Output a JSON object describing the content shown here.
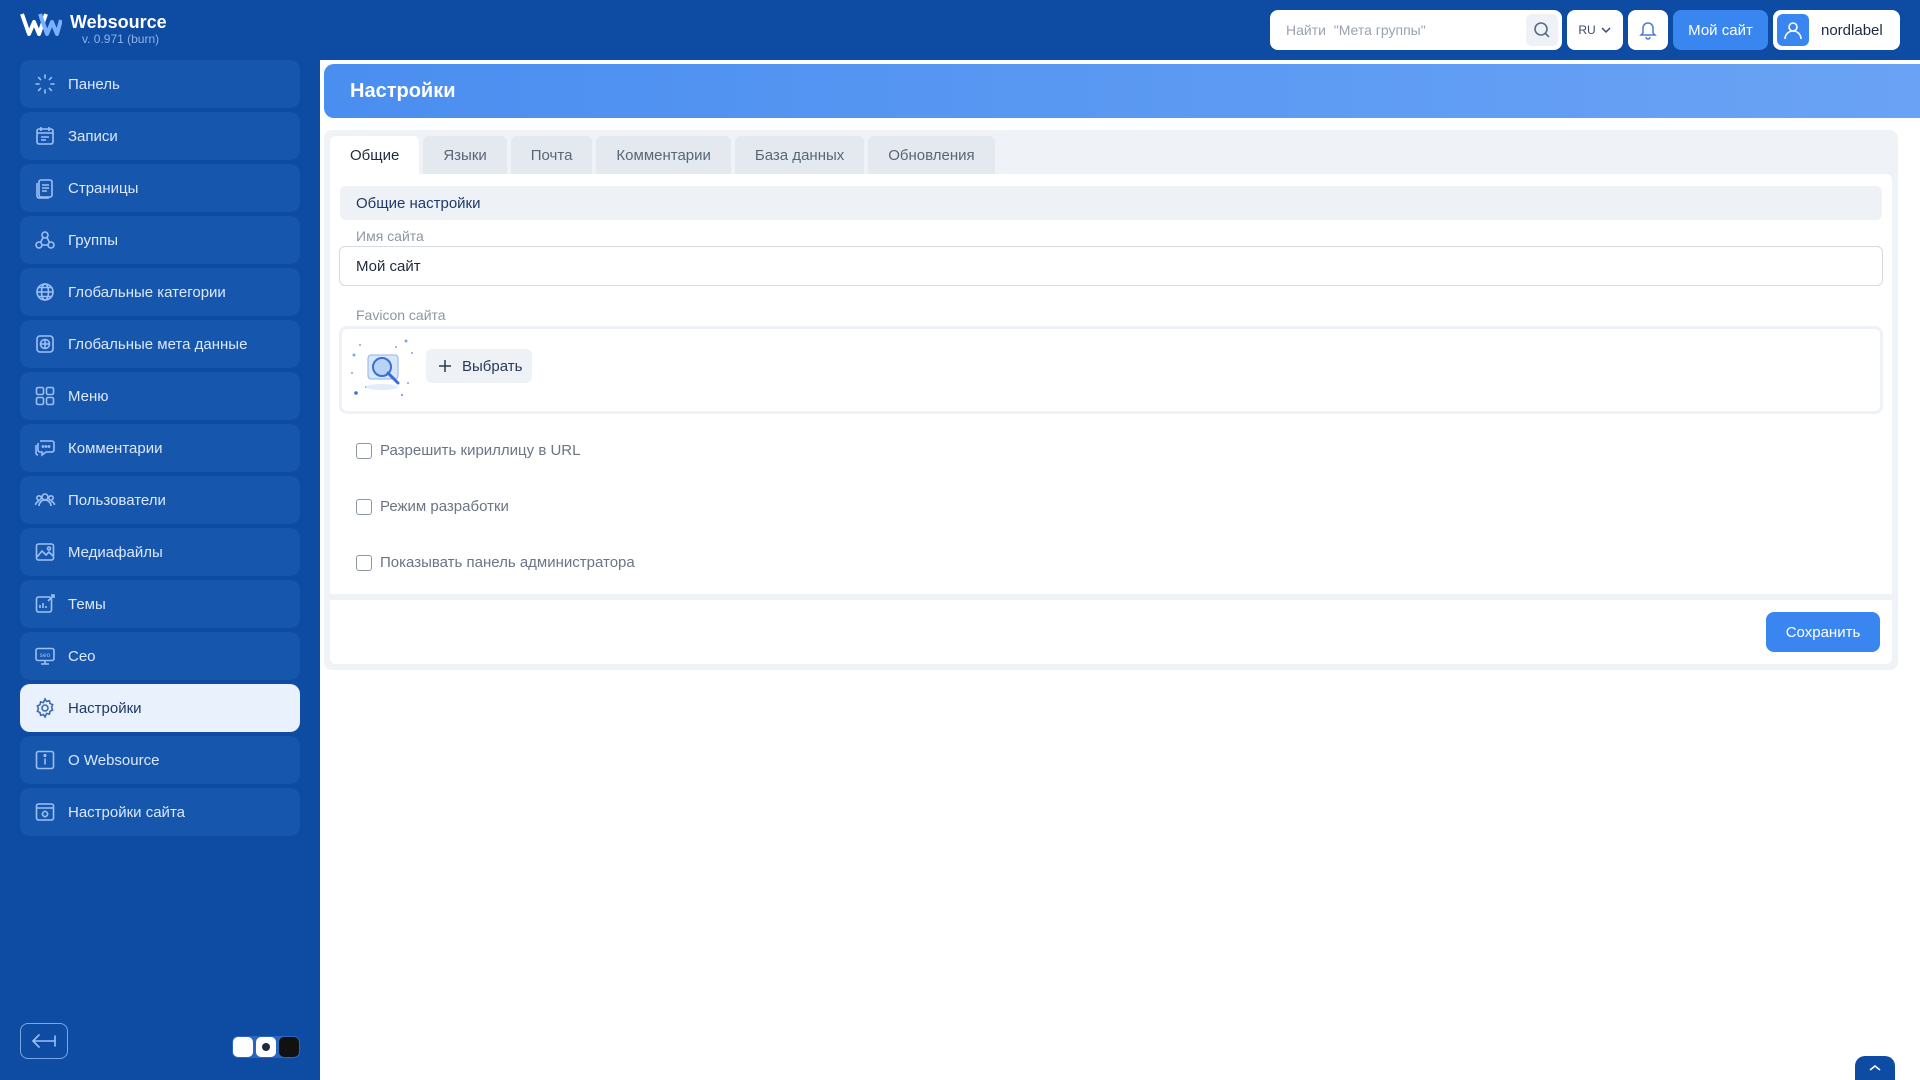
{
  "app": {
    "name": "Websource",
    "version": "v. 0.971 (burn)"
  },
  "header": {
    "search_placeholder": "Найти  \"Мета группы\"",
    "lang": "RU",
    "my_site_label": "Мой сайт",
    "username": "nordlabel"
  },
  "sidebar": {
    "items": [
      {
        "label": "Панель",
        "icon": "dashboard-icon"
      },
      {
        "label": "Записи",
        "icon": "posts-icon"
      },
      {
        "label": "Страницы",
        "icon": "pages-icon"
      },
      {
        "label": "Группы",
        "icon": "groups-icon"
      },
      {
        "label": "Глобальные категории",
        "icon": "global-categories-icon"
      },
      {
        "label": "Глобальные мета данные",
        "icon": "global-meta-icon"
      },
      {
        "label": "Меню",
        "icon": "menu-grid-icon"
      },
      {
        "label": "Комментарии",
        "icon": "comments-icon"
      },
      {
        "label": "Пользователи",
        "icon": "users-icon"
      },
      {
        "label": "Медиафайлы",
        "icon": "media-icon"
      },
      {
        "label": "Темы",
        "icon": "themes-icon"
      },
      {
        "label": "Сео",
        "icon": "seo-icon"
      },
      {
        "label": "Настройки",
        "icon": "gear-icon"
      },
      {
        "label": "О Websource",
        "icon": "info-icon"
      },
      {
        "label": "Настройки сайта",
        "icon": "site-settings-icon"
      }
    ],
    "active_index": 12
  },
  "page": {
    "title": "Настройки"
  },
  "tabs": [
    {
      "label": "Общие",
      "active": true
    },
    {
      "label": "Языки",
      "active": false
    },
    {
      "label": "Почта",
      "active": false
    },
    {
      "label": "Комментарии",
      "active": false
    },
    {
      "label": "База данных",
      "active": false
    },
    {
      "label": "Обновления",
      "active": false
    }
  ],
  "form": {
    "section_title": "Общие настройки",
    "site_name_label": "Имя сайта",
    "site_name_value": "Мой сайт",
    "favicon_label": "Favicon сайта",
    "pick_label": "Выбрать",
    "checkboxes": [
      {
        "label": "Разрешить кириллицу в URL",
        "checked": false
      },
      {
        "label": "Режим разработки",
        "checked": false
      },
      {
        "label": "Показывать панель администратора",
        "checked": false
      }
    ],
    "save_label": "Сохранить"
  },
  "colors": {
    "sidebar_bg": "#0d4ca2",
    "accent": "#3a86f0",
    "header_gradient_start": "#4a8ef0"
  }
}
